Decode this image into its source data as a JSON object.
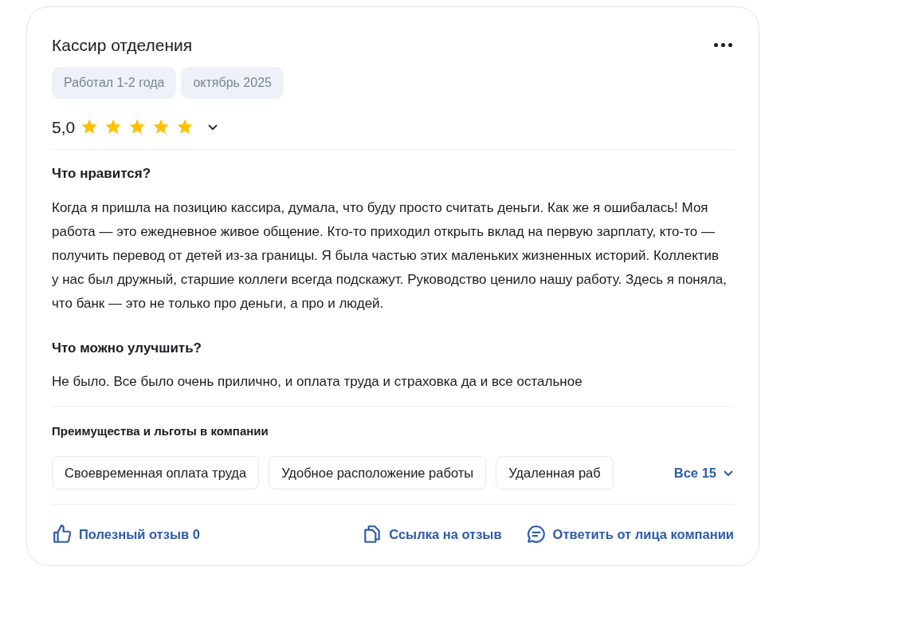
{
  "review": {
    "title": "Кассир отделения",
    "tags": [
      "Работал 1-2 года",
      "октябрь 2025"
    ],
    "rating": "5,0",
    "stars": 5,
    "sections": [
      {
        "heading": "Что нравится?",
        "text": "Когда я пришла на позицию кассира, думала, что буду просто считать деньги. Как же я ошибалась! Моя работа — это ежедневное живое общение. Кто-то приходил открыть вклад на первую зарплату, кто-то — получить перевод от детей из-за границы. Я была частью этих маленьких жизненных историй. Коллектив у нас был дружный, старшие коллеги всегда подскажут. Руководство ценило нашу работу. Здесь я поняла, что банк — это не только про деньги, а про и людей."
      },
      {
        "heading": "Что можно улучшить?",
        "text": "Не было. Все было очень прилично, и оплата труда и страховка да и все остальное"
      }
    ],
    "benefits": {
      "heading": "Преимущества и льготы в компании",
      "items": [
        "Своевременная оплата труда",
        "Удобное расположение работы",
        "Удаленная раб"
      ],
      "more": "Все 15"
    },
    "actions": [
      {
        "kind": "like",
        "label": "Полезный отзыв 0"
      },
      {
        "kind": "link",
        "label": "Ссылка на отзыв"
      },
      {
        "kind": "reply",
        "label": "Ответить от лица компании"
      }
    ]
  }
}
